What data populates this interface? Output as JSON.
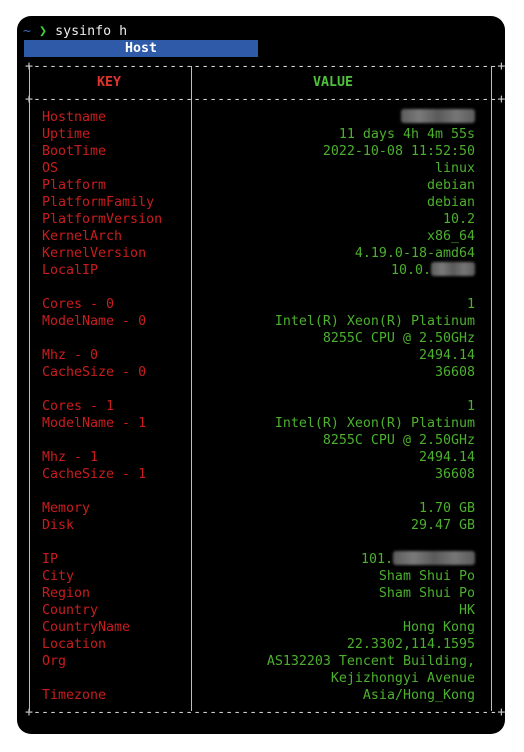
{
  "prompt": {
    "tilde": "~",
    "arrow": "❯",
    "command": "sysinfo h"
  },
  "host_title": "Host",
  "header": {
    "key": "KEY",
    "value": "VALUE"
  },
  "separator": "+----------------------------------------------------------+",
  "rows": [
    {
      "key": "Hostname",
      "value": "",
      "redacted": true
    },
    {
      "key": "Uptime",
      "value": "11 days 4h 4m 55s"
    },
    {
      "key": "BootTime",
      "value": "2022-10-08 11:52:50"
    },
    {
      "key": "OS",
      "value": "linux"
    },
    {
      "key": "Platform",
      "value": "debian"
    },
    {
      "key": "PlatformFamily",
      "value": "debian"
    },
    {
      "key": "PlatformVersion",
      "value": "10.2"
    },
    {
      "key": "KernelArch",
      "value": "x86_64"
    },
    {
      "key": "KernelVersion",
      "value": "4.19.0-18-amd64"
    },
    {
      "key": "LocalIP",
      "value": "10.0.",
      "redacted": true
    },
    {
      "key": "",
      "value": ""
    },
    {
      "key": "Cores - 0",
      "value": "1"
    },
    {
      "key": "ModelName - 0",
      "value": "Intel(R) Xeon(R) Platinum"
    },
    {
      "key": "",
      "value": "8255C CPU @ 2.50GHz"
    },
    {
      "key": "Mhz - 0",
      "value": "2494.14"
    },
    {
      "key": "CacheSize - 0",
      "value": "36608"
    },
    {
      "key": "",
      "value": ""
    },
    {
      "key": "Cores - 1",
      "value": "1"
    },
    {
      "key": "ModelName - 1",
      "value": "Intel(R) Xeon(R) Platinum"
    },
    {
      "key": "",
      "value": "8255C CPU @ 2.50GHz"
    },
    {
      "key": "Mhz - 1",
      "value": "2494.14"
    },
    {
      "key": "CacheSize - 1",
      "value": "36608"
    },
    {
      "key": "",
      "value": ""
    },
    {
      "key": "Memory",
      "value": "1.70 GB"
    },
    {
      "key": "Disk",
      "value": "29.47 GB"
    },
    {
      "key": "",
      "value": ""
    },
    {
      "key": "IP",
      "value": "101.",
      "redacted": true
    },
    {
      "key": "City",
      "value": "Sham Shui Po"
    },
    {
      "key": "Region",
      "value": "Sham Shui Po"
    },
    {
      "key": "Country",
      "value": "HK"
    },
    {
      "key": "CountryName",
      "value": "Hong Kong"
    },
    {
      "key": "Location",
      "value": "22.3302,114.1595"
    },
    {
      "key": "Org",
      "value": "AS132203 Tencent Building,"
    },
    {
      "key": "",
      "value": "Kejizhongyi Avenue"
    },
    {
      "key": "Timezone",
      "value": "Asia/Hong_Kong"
    }
  ]
}
